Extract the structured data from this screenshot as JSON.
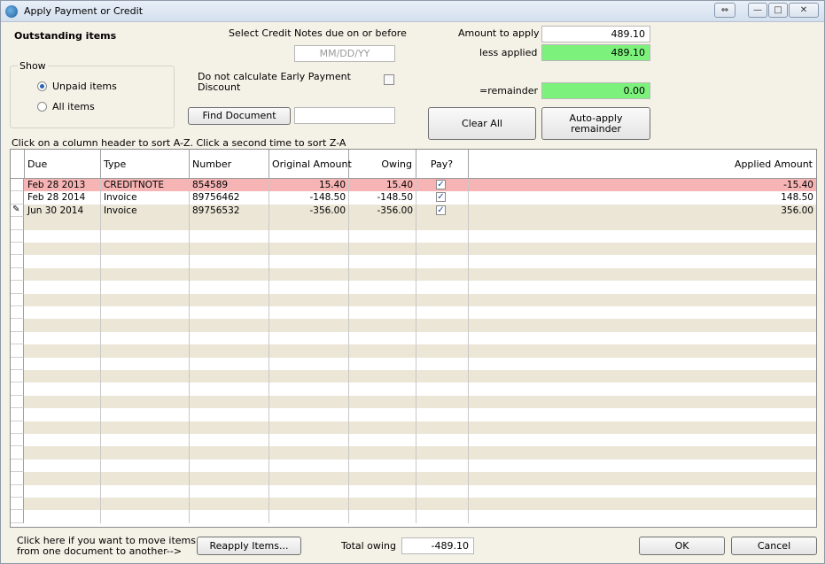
{
  "window": {
    "title": "Apply Payment or Credit"
  },
  "top": {
    "outstanding_label": "Outstanding items",
    "select_credit_label": "Select Credit Notes due on or before",
    "date_placeholder": "MM/DD/YY",
    "show_label": "Show",
    "radio_unpaid": "Unpaid items",
    "radio_all": "All items",
    "no_discount_label_1": "Do not calculate Early Payment",
    "no_discount_label_2": "Discount",
    "find_document_button": "Find Document",
    "find_document_value": "",
    "amount_to_apply_label": "Amount to apply",
    "amount_to_apply_value": "489.10",
    "less_applied_label": "less applied",
    "less_applied_value": "489.10",
    "remainder_label": "=remainder",
    "remainder_value": "0.00",
    "clear_all_button": "Clear All",
    "auto_apply_line1": "Auto-apply",
    "auto_apply_line2": "remainder",
    "sort_hint": "Click on a column header to sort A-Z.  Click a second time to sort Z-A"
  },
  "grid": {
    "columns": [
      "Due",
      "Type",
      "Number",
      "Original Amount",
      "Owing",
      "Pay?",
      "Applied Amount"
    ],
    "rows": [
      {
        "due": "Feb 28 2013",
        "type": "CREDITNOTE",
        "number": "854589",
        "original": "15.40",
        "owing": "15.40",
        "pay": true,
        "applied": "-15.40"
      },
      {
        "due": "Feb 28 2014",
        "type": "Invoice",
        "number": "89756462",
        "original": "-148.50",
        "owing": "-148.50",
        "pay": true,
        "applied": "148.50"
      },
      {
        "due": "Jun 30 2014",
        "type": "Invoice",
        "number": "89756532",
        "original": "-356.00",
        "owing": "-356.00",
        "pay": true,
        "applied": "356.00"
      }
    ]
  },
  "bottom": {
    "move_hint_1": "Click here if you want to move items",
    "move_hint_2": "from one document to another-->",
    "reapply_button": "Reapply Items...",
    "total_owing_label": "Total owing",
    "total_owing_value": "-489.10",
    "ok_button": "OK",
    "cancel_button": "Cancel"
  },
  "colors": {
    "highlight_row": "#f6b4b4",
    "green_field": "#7cf27c",
    "stripe": "#ebe6d6"
  }
}
